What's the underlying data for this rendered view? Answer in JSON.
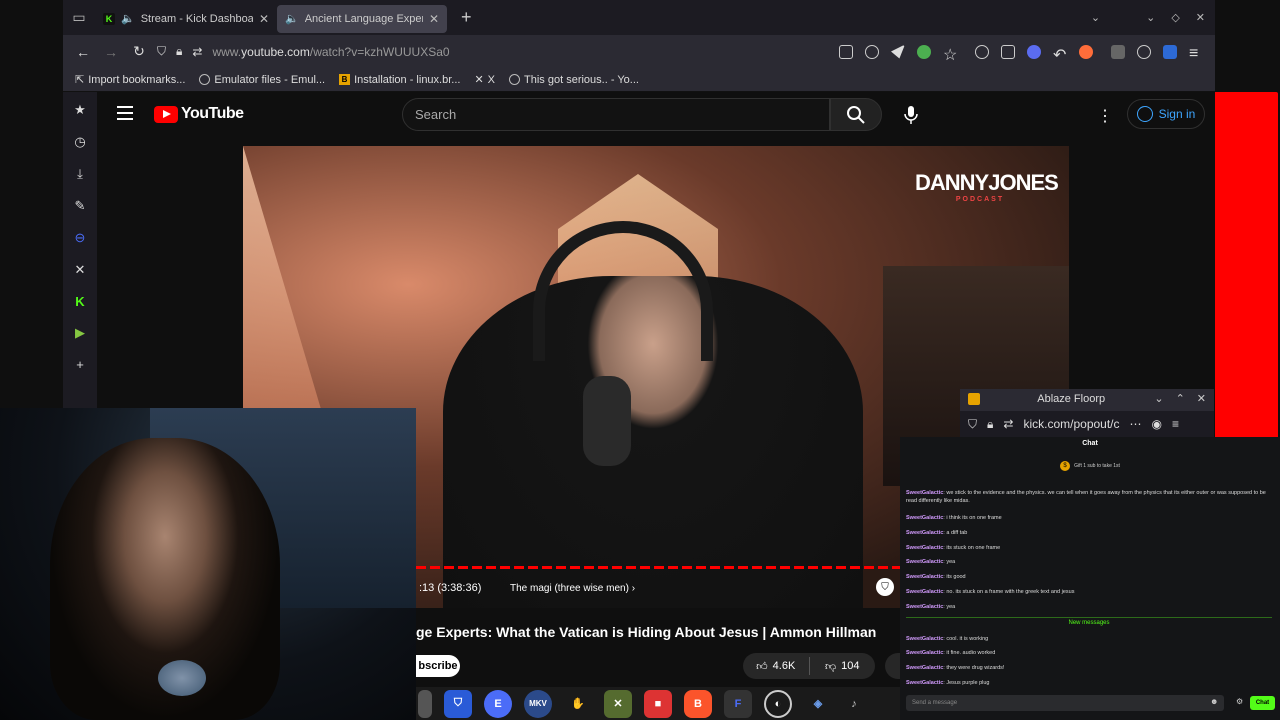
{
  "browser": {
    "tabs": [
      {
        "title": "Stream - Kick Dashboard",
        "audio": "🔈"
      },
      {
        "title": "Ancient Language Experts",
        "audio": "🔈"
      }
    ],
    "url_prefix": "www.",
    "url_domain": "youtube.com",
    "url_path": "/watch?v=kzhWUUUXSa0",
    "bookmarks": [
      "Import bookmarks...",
      "Emulator files - Emul...",
      "Installation - linux.br...",
      "X",
      "This got serious.. - Yo..."
    ]
  },
  "youtube": {
    "logo_text": "YouTube",
    "search_placeholder": "Search",
    "signin_label": "Sign in",
    "podcast_logo": "DANNYJONES",
    "podcast_sub": "PODCAST",
    "timecode": ":13 (3:38:36)",
    "chapter": "The magi (three wise men)",
    "video_title": "ge Experts: What the Vatican is Hiding About Jesus | Ammon Hillman",
    "subscribe_label": "bscribe",
    "likes": "4.6K",
    "dislikes": "104"
  },
  "kick_popout": {
    "window_title": "Ablaze Floorp",
    "url": "kick.com/popout/c"
  },
  "chat": {
    "header": "Chat",
    "gift_text": "Gift 1 sub to take 1st",
    "messages": [
      {
        "user": "SweetGalactic",
        "text": ": we stick to the evidence and the physics. we can tell when it goes away from the physics that its either outer or was supposed to be read differently like midas."
      },
      {
        "user": "SweetGalactic",
        "text": ": i think its on one frame"
      },
      {
        "user": "SweetGalactic",
        "text": ": a diff tab"
      },
      {
        "user": "SweetGalactic",
        "text": ": its stuck on one frame"
      },
      {
        "user": "SweetGalactic",
        "text": ": yea"
      },
      {
        "user": "SweetGalactic",
        "text": ": its good"
      },
      {
        "user": "SweetGalactic",
        "text": ": no. its stuck on a frame with the greek text and jesus"
      },
      {
        "user": "SweetGalactic",
        "text": ": yea"
      }
    ],
    "new_messages_label": "New messages",
    "new_messages": [
      {
        "user": "SweetGalactic",
        "text": ": cool. it is working"
      },
      {
        "user": "SweetGalactic",
        "text": ": it fine. audio worked"
      },
      {
        "user": "SweetGalactic",
        "text": ": they were drug wizards!"
      },
      {
        "user": "SweetGalactic",
        "text": ": Jesus purple plug"
      }
    ],
    "input_placeholder": "Send a message",
    "send_label": "Chat"
  },
  "taskbar": {
    "items": [
      "E",
      "M",
      "KV",
      "✋",
      "✕",
      "■",
      "B",
      "F",
      "◐",
      "◈",
      "♪"
    ]
  },
  "colors": {
    "youtube_red": "#ff0000",
    "kick_green": "#53fc18",
    "link_blue": "#3ea6ff",
    "chat_username": "#d39cff"
  }
}
